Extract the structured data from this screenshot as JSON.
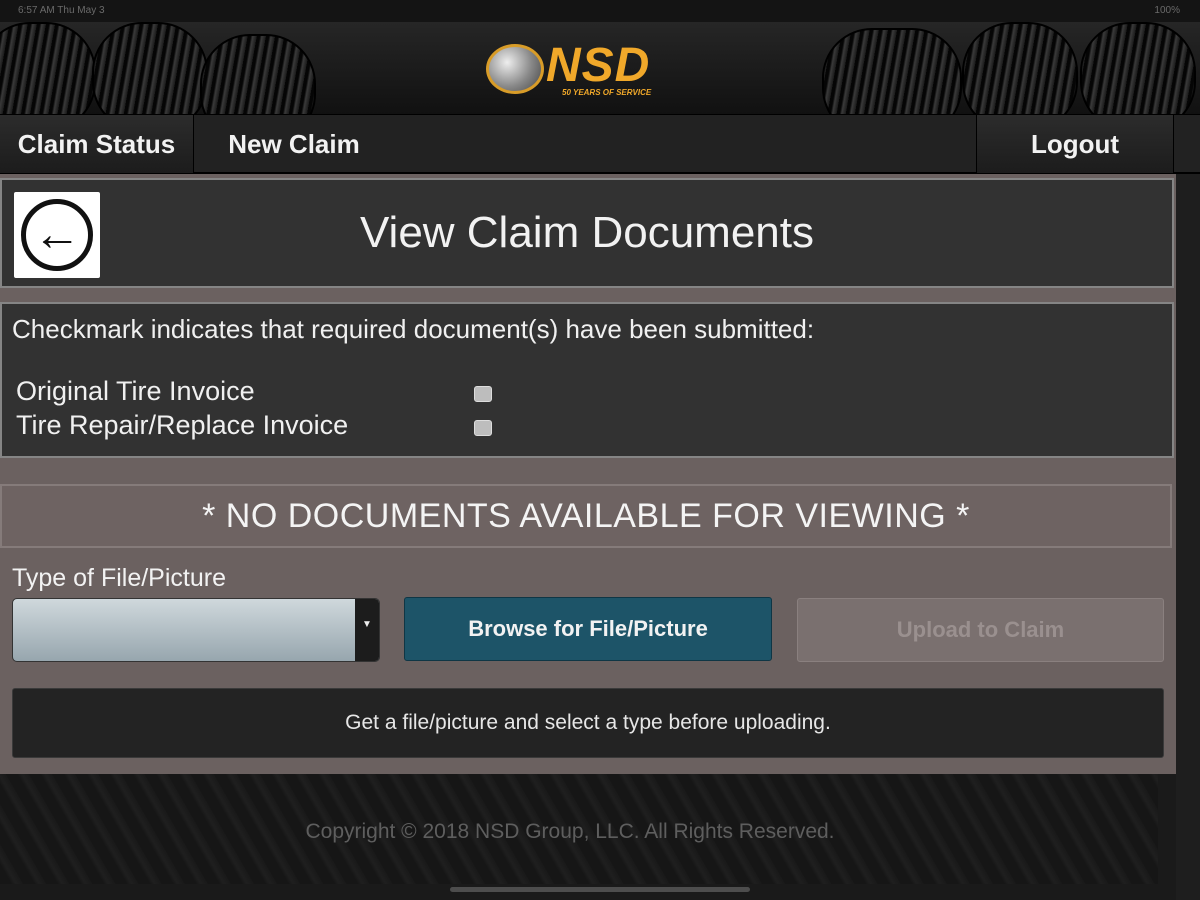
{
  "status_bar": {
    "time": "6:57 AM   Thu May 3",
    "right": "100%"
  },
  "header": {
    "logo_text": "NSD",
    "logo_sub": "50 YEARS OF SERVICE"
  },
  "nav": {
    "claim_status": "Claim Status",
    "new_claim": "New Claim",
    "logout": "Logout"
  },
  "page": {
    "title": "View Claim Documents"
  },
  "documents": {
    "intro": "Checkmark indicates that required document(s) have been submitted:",
    "items": [
      {
        "label": "Original Tire Invoice",
        "checked": false
      },
      {
        "label": "Tire Repair/Replace Invoice",
        "checked": false
      }
    ]
  },
  "no_docs_message": "* NO DOCUMENTS AVAILABLE FOR VIEWING *",
  "upload": {
    "type_label": "Type of File/Picture",
    "selected_type": "",
    "browse_label": "Browse for File/Picture",
    "upload_label": "Upload to Claim",
    "hint": "Get a file/picture and select a type before uploading."
  },
  "footer": {
    "copyright": "Copyright © 2018 NSD Group, LLC. All Rights Reserved."
  }
}
